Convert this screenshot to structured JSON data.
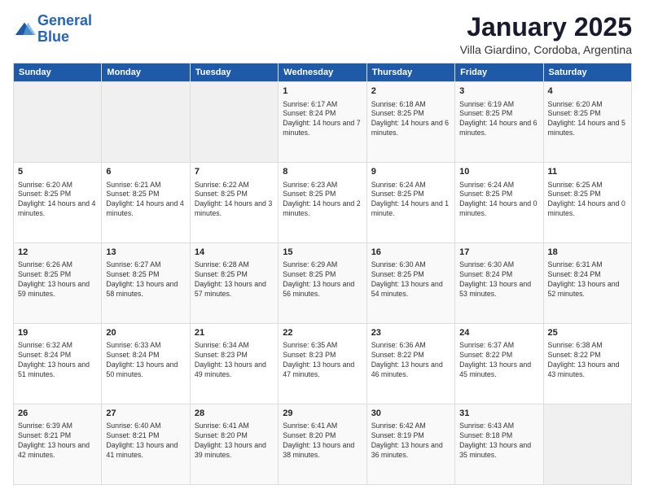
{
  "logo": {
    "line1": "General",
    "line2": "Blue"
  },
  "title": "January 2025",
  "subtitle": "Villa Giardino, Cordoba, Argentina",
  "days_of_week": [
    "Sunday",
    "Monday",
    "Tuesday",
    "Wednesday",
    "Thursday",
    "Friday",
    "Saturday"
  ],
  "weeks": [
    [
      {
        "day": "",
        "content": ""
      },
      {
        "day": "",
        "content": ""
      },
      {
        "day": "",
        "content": ""
      },
      {
        "day": "1",
        "content": "Sunrise: 6:17 AM\nSunset: 8:24 PM\nDaylight: 14 hours\nand 7 minutes."
      },
      {
        "day": "2",
        "content": "Sunrise: 6:18 AM\nSunset: 8:25 PM\nDaylight: 14 hours\nand 6 minutes."
      },
      {
        "day": "3",
        "content": "Sunrise: 6:19 AM\nSunset: 8:25 PM\nDaylight: 14 hours\nand 6 minutes."
      },
      {
        "day": "4",
        "content": "Sunrise: 6:20 AM\nSunset: 8:25 PM\nDaylight: 14 hours\nand 5 minutes."
      }
    ],
    [
      {
        "day": "5",
        "content": "Sunrise: 6:20 AM\nSunset: 8:25 PM\nDaylight: 14 hours\nand 4 minutes."
      },
      {
        "day": "6",
        "content": "Sunrise: 6:21 AM\nSunset: 8:25 PM\nDaylight: 14 hours\nand 4 minutes."
      },
      {
        "day": "7",
        "content": "Sunrise: 6:22 AM\nSunset: 8:25 PM\nDaylight: 14 hours\nand 3 minutes."
      },
      {
        "day": "8",
        "content": "Sunrise: 6:23 AM\nSunset: 8:25 PM\nDaylight: 14 hours\nand 2 minutes."
      },
      {
        "day": "9",
        "content": "Sunrise: 6:24 AM\nSunset: 8:25 PM\nDaylight: 14 hours\nand 1 minute."
      },
      {
        "day": "10",
        "content": "Sunrise: 6:24 AM\nSunset: 8:25 PM\nDaylight: 14 hours\nand 0 minutes."
      },
      {
        "day": "11",
        "content": "Sunrise: 6:25 AM\nSunset: 8:25 PM\nDaylight: 14 hours\nand 0 minutes."
      }
    ],
    [
      {
        "day": "12",
        "content": "Sunrise: 6:26 AM\nSunset: 8:25 PM\nDaylight: 13 hours\nand 59 minutes."
      },
      {
        "day": "13",
        "content": "Sunrise: 6:27 AM\nSunset: 8:25 PM\nDaylight: 13 hours\nand 58 minutes."
      },
      {
        "day": "14",
        "content": "Sunrise: 6:28 AM\nSunset: 8:25 PM\nDaylight: 13 hours\nand 57 minutes."
      },
      {
        "day": "15",
        "content": "Sunrise: 6:29 AM\nSunset: 8:25 PM\nDaylight: 13 hours\nand 56 minutes."
      },
      {
        "day": "16",
        "content": "Sunrise: 6:30 AM\nSunset: 8:25 PM\nDaylight: 13 hours\nand 54 minutes."
      },
      {
        "day": "17",
        "content": "Sunrise: 6:30 AM\nSunset: 8:24 PM\nDaylight: 13 hours\nand 53 minutes."
      },
      {
        "day": "18",
        "content": "Sunrise: 6:31 AM\nSunset: 8:24 PM\nDaylight: 13 hours\nand 52 minutes."
      }
    ],
    [
      {
        "day": "19",
        "content": "Sunrise: 6:32 AM\nSunset: 8:24 PM\nDaylight: 13 hours\nand 51 minutes."
      },
      {
        "day": "20",
        "content": "Sunrise: 6:33 AM\nSunset: 8:24 PM\nDaylight: 13 hours\nand 50 minutes."
      },
      {
        "day": "21",
        "content": "Sunrise: 6:34 AM\nSunset: 8:23 PM\nDaylight: 13 hours\nand 49 minutes."
      },
      {
        "day": "22",
        "content": "Sunrise: 6:35 AM\nSunset: 8:23 PM\nDaylight: 13 hours\nand 47 minutes."
      },
      {
        "day": "23",
        "content": "Sunrise: 6:36 AM\nSunset: 8:22 PM\nDaylight: 13 hours\nand 46 minutes."
      },
      {
        "day": "24",
        "content": "Sunrise: 6:37 AM\nSunset: 8:22 PM\nDaylight: 13 hours\nand 45 minutes."
      },
      {
        "day": "25",
        "content": "Sunrise: 6:38 AM\nSunset: 8:22 PM\nDaylight: 13 hours\nand 43 minutes."
      }
    ],
    [
      {
        "day": "26",
        "content": "Sunrise: 6:39 AM\nSunset: 8:21 PM\nDaylight: 13 hours\nand 42 minutes."
      },
      {
        "day": "27",
        "content": "Sunrise: 6:40 AM\nSunset: 8:21 PM\nDaylight: 13 hours\nand 41 minutes."
      },
      {
        "day": "28",
        "content": "Sunrise: 6:41 AM\nSunset: 8:20 PM\nDaylight: 13 hours\nand 39 minutes."
      },
      {
        "day": "29",
        "content": "Sunrise: 6:41 AM\nSunset: 8:20 PM\nDaylight: 13 hours\nand 38 minutes."
      },
      {
        "day": "30",
        "content": "Sunrise: 6:42 AM\nSunset: 8:19 PM\nDaylight: 13 hours\nand 36 minutes."
      },
      {
        "day": "31",
        "content": "Sunrise: 6:43 AM\nSunset: 8:18 PM\nDaylight: 13 hours\nand 35 minutes."
      },
      {
        "day": "",
        "content": ""
      }
    ]
  ]
}
